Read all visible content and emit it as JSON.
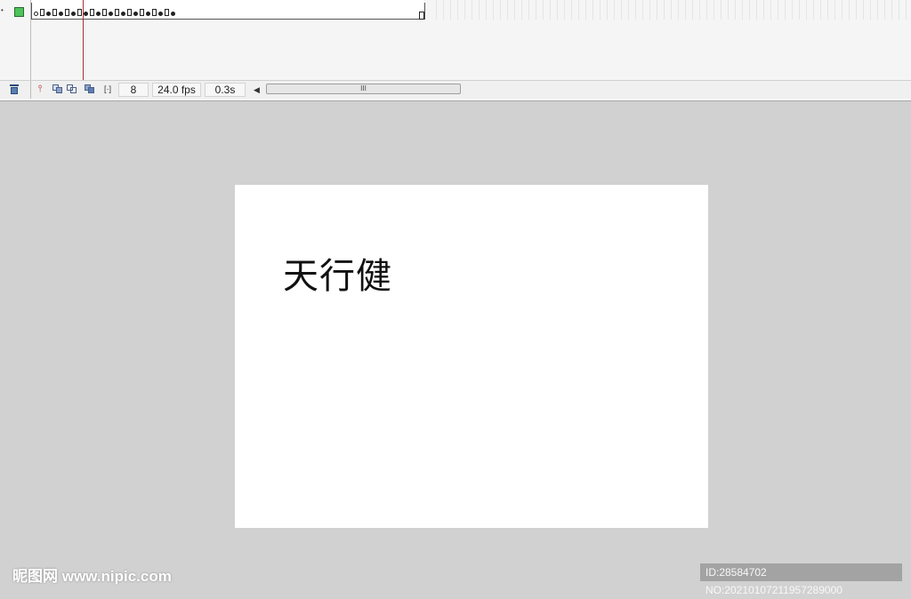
{
  "timeline": {
    "keyframes": [
      "empty",
      "end",
      "full",
      "end",
      "full",
      "end",
      "full",
      "end",
      "full",
      "end",
      "full",
      "end",
      "full",
      "end",
      "full",
      "end",
      "full",
      "end",
      "full",
      "end",
      "full",
      "end",
      "full"
    ]
  },
  "statusbar": {
    "current_frame": "8",
    "frame_rate": "24.0 fps",
    "elapsed_time": "0.3s",
    "scroll_grip": "III"
  },
  "stage": {
    "text": "天行健"
  },
  "watermark": {
    "left": "昵图网 www.nipic.com",
    "right": "ID:28584702 NO:20210107211957289000"
  },
  "colors": {
    "layer_color": "#4ec35a",
    "playhead": "#b03030",
    "stage_bg": "#ffffff",
    "workspace_bg": "#d1d1d1"
  },
  "icons": [
    "trash-icon",
    "edit-multiple-frames-icon",
    "onion-skin-icon",
    "onion-skin-outlines-icon",
    "modify-onion-markers-icon",
    "center-frame-icon"
  ]
}
